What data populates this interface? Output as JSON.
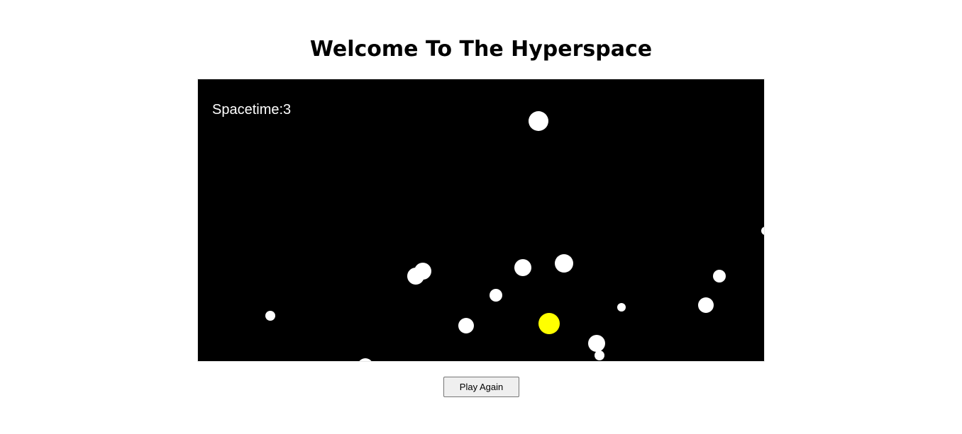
{
  "page": {
    "title": "Welcome To The Hyperspace"
  },
  "game": {
    "score_text": "Spacetime:3",
    "colors": {
      "background": "#000000",
      "asteroid": "#ffffff",
      "player": "#ffff00"
    }
  },
  "controls": {
    "play_again_label": "Play Again"
  }
}
